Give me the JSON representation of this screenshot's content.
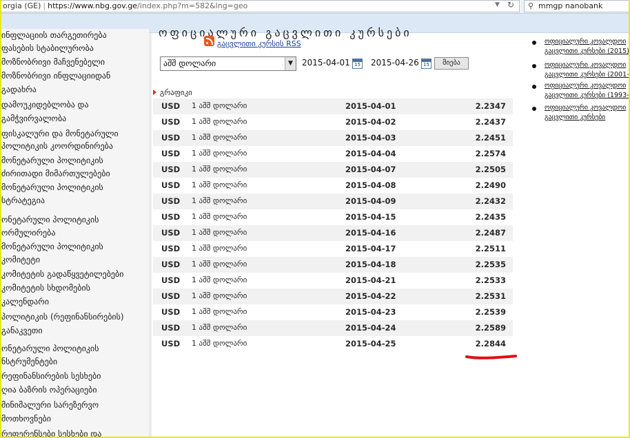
{
  "browser": {
    "site_label": "orgia (GE)",
    "url_domain": "https://www.nbg.gov.ge",
    "url_path": "/index.php?m=582&lng=geo",
    "search_text": "mmgp nanobank"
  },
  "sidebar": {
    "items": [
      "ინფლაციის თარგეთირება",
      "ფასების სტაბილურობა",
      "მოზნობრივი მაჩვენებელი",
      "მოზნობრივი ინფლაციიდან",
      "გადახრა",
      "დამოუკიდებლობა და",
      "გამჭვირვალობა",
      "ფისკალური და მონეტარული",
      "პოლიტიკის კოორდინირება",
      "მონეტარული პოლიტიკის",
      "ძირითადი მიმართულებები",
      "მონეტარული პოლიტიკის",
      "სტრატეგია",
      "ონეტარული პოლიტიკის",
      "ორმულირება",
      "მონეტარული პოლიტიკის",
      "კომიტეტი",
      "კომიტეტის გადაწყვეტილებები",
      "კომიტეტის სხდომების",
      "კალენდარი",
      "პოლიტიკის (რეფინანსირების)",
      "განაკვეთი",
      "ონეტარული პოლიტიკის",
      "ნსტრუმენტები",
      "რეფინანსირების სესხები",
      "ღია ბაზრის ოპერაციები",
      "მინიმალური სარეზერვო",
      "მოთხოვნები",
      "რეფერენსები სესხები და"
    ]
  },
  "main": {
    "heading_clipped": "ოფიციალური გაცვლითი კურსები",
    "rss_label": "გაცვლითი კურსის RSS",
    "currency_selected": "აშშ დოლარი",
    "date_from": "2015-04-01",
    "date_to": "2015-04-26",
    "calendar_icon_label": "15",
    "go_button_label": "მიება",
    "graph_label": "გრაფიკი",
    "rates": [
      {
        "code": "USD",
        "name": "1 აშშ დოლარი",
        "date": "2015-04-01",
        "rate": "2.2347"
      },
      {
        "code": "USD",
        "name": "1 აშშ დოლარი",
        "date": "2015-04-02",
        "rate": "2.2437"
      },
      {
        "code": "USD",
        "name": "1 აშშ დოლარი",
        "date": "2015-04-03",
        "rate": "2.2451"
      },
      {
        "code": "USD",
        "name": "1 აშშ დოლარი",
        "date": "2015-04-04",
        "rate": "2.2574"
      },
      {
        "code": "USD",
        "name": "1 აშშ დოლარი",
        "date": "2015-04-07",
        "rate": "2.2505"
      },
      {
        "code": "USD",
        "name": "1 აშშ დოლარი",
        "date": "2015-04-08",
        "rate": "2.2490"
      },
      {
        "code": "USD",
        "name": "1 აშშ დოლარი",
        "date": "2015-04-09",
        "rate": "2.2432"
      },
      {
        "code": "USD",
        "name": "1 აშშ დოლარი",
        "date": "2015-04-15",
        "rate": "2.2435"
      },
      {
        "code": "USD",
        "name": "1 აშშ დოლარი",
        "date": "2015-04-16",
        "rate": "2.2487"
      },
      {
        "code": "USD",
        "name": "1 აშშ დოლარი",
        "date": "2015-04-17",
        "rate": "2.2511"
      },
      {
        "code": "USD",
        "name": "1 აშშ დოლარი",
        "date": "2015-04-18",
        "rate": "2.2535"
      },
      {
        "code": "USD",
        "name": "1 აშშ დოლარი",
        "date": "2015-04-21",
        "rate": "2.2533"
      },
      {
        "code": "USD",
        "name": "1 აშშ დოლარი",
        "date": "2015-04-22",
        "rate": "2.2531"
      },
      {
        "code": "USD",
        "name": "1 აშშ დოლარი",
        "date": "2015-04-23",
        "rate": "2.2539"
      },
      {
        "code": "USD",
        "name": "1 აშშ დოლარი",
        "date": "2015-04-24",
        "rate": "2.2589"
      },
      {
        "code": "USD",
        "name": "1 აშშ დოლარი",
        "date": "2015-04-25",
        "rate": "2.2844"
      }
    ]
  },
  "rightpanel": {
    "items": [
      {
        "line1": "ოფიციალური კოვალდოი",
        "line2": "გაცვლითი კურსები (2015)"
      },
      {
        "line1": "ოფიციალური კოვალდოი",
        "line2": "გაცვლითი კურსები (2001-2"
      },
      {
        "line1": "ოფიციალური კოვალდოი",
        "line2": "გაცვლითი კურსები (1993-2"
      },
      {
        "line1": "ოფიციალური კოვალდოი",
        "line2": "გაცვლითი კურსები"
      }
    ]
  },
  "colors": {
    "row_stripe": "#f1f1f1",
    "annotation_red": "#e01010",
    "rss_orange": "#e65b1a",
    "link_blue": "#1a3e9c"
  }
}
